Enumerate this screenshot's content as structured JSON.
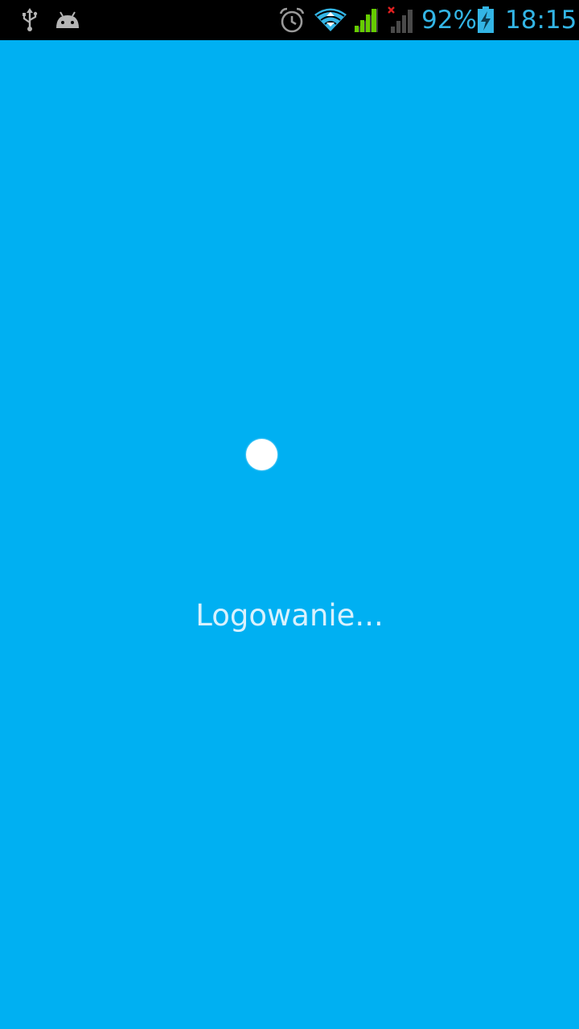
{
  "status_bar": {
    "battery_percent": "92%",
    "time": "18:15",
    "icons_left": [
      "usb-icon",
      "android-debug-icon"
    ],
    "icons_right": [
      "alarm-icon",
      "wifi-icon",
      "signal-icon",
      "signal-no-data-icon",
      "battery-charging-icon"
    ],
    "battery_level": 0.92,
    "text_color": "#33b5e5"
  },
  "screen": {
    "background_color": "#00b0f2",
    "loading_label": "Logowanie..."
  }
}
